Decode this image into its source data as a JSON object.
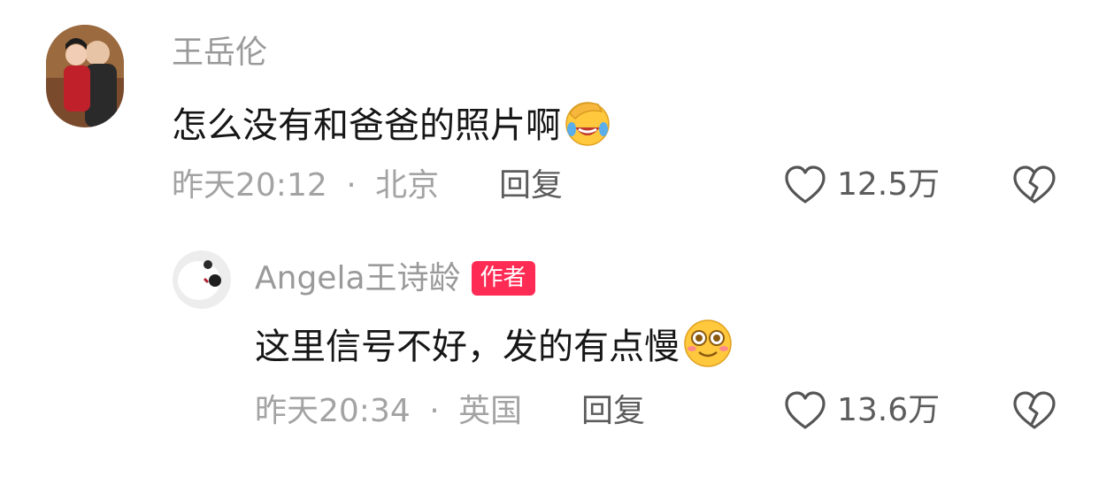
{
  "comment": {
    "author": "王岳伦",
    "text": "怎么没有和爸爸的照片啊",
    "emoji": "facepalm-crying-laughing",
    "time": "昨天20:12",
    "separator": "·",
    "location": "北京",
    "reply_label": "回复",
    "likes": "12.5万"
  },
  "reply": {
    "author": "Angela王诗龄",
    "badge": "作者",
    "text": "这里信号不好，发的有点慢",
    "emoji": "smiling-face",
    "time": "昨天20:34",
    "separator": "·",
    "location": "英国",
    "reply_label": "回复",
    "likes": "13.6万"
  },
  "icons": {
    "like": "heart-outline-icon",
    "dislike": "broken-heart-icon"
  },
  "colors": {
    "badge": "#fe2c55",
    "name": "#9a9a9a",
    "meta": "#a3a3a3"
  }
}
